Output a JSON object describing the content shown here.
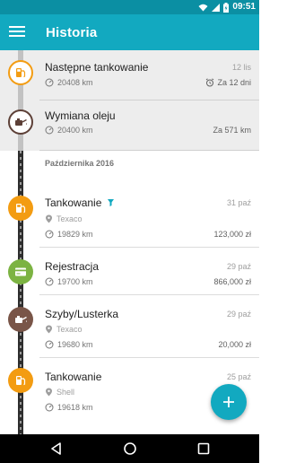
{
  "status_bar": {
    "time": "09:51",
    "icons": [
      "wifi-icon",
      "signal-icon",
      "battery-charging-icon"
    ]
  },
  "app_bar": {
    "title": "Historia",
    "menu_icon": "hamburger-menu-icon"
  },
  "colors": {
    "accent": "#12a9c0",
    "status_bar": "#0b8fa3",
    "fuel": "#f39c12",
    "registration": "#7cb342",
    "service": "#795548"
  },
  "upcoming": [
    {
      "title": "Następne tankowanie",
      "date": "12 lis",
      "odometer": "20408 km",
      "due": "Za 12 dni",
      "icon": "fuel-pump-icon",
      "due_icon": "alarm-clock-icon"
    },
    {
      "title": "Wymiana oleju",
      "odometer": "20400 km",
      "due": "Za 571 km",
      "icon": "oil-can-icon"
    }
  ],
  "section": {
    "header": "Października 2016"
  },
  "entries": [
    {
      "title": "Tankowanie",
      "date": "31 paź",
      "station": "Texaco",
      "odometer": "19829 km",
      "amount": "123,000 zł",
      "icon": "fuel-pump-icon",
      "badge_icon": "full-tank-icon"
    },
    {
      "title": "Rejestracja",
      "date": "29 paź",
      "odometer": "19700 km",
      "amount": "866,000 zł",
      "icon": "registration-card-icon"
    },
    {
      "title": "Szyby/Lusterka",
      "date": "29 paź",
      "station": "Texaco",
      "odometer": "19680 km",
      "amount": "20,000 zł",
      "icon": "oil-can-icon"
    },
    {
      "title": "Tankowanie",
      "date": "25 paź",
      "station": "Shell",
      "odometer": "19618 km",
      "icon": "fuel-pump-icon"
    }
  ],
  "fab": {
    "icon": "plus-icon"
  },
  "nav": {
    "icons": [
      "back-icon",
      "home-icon",
      "recents-icon"
    ]
  }
}
